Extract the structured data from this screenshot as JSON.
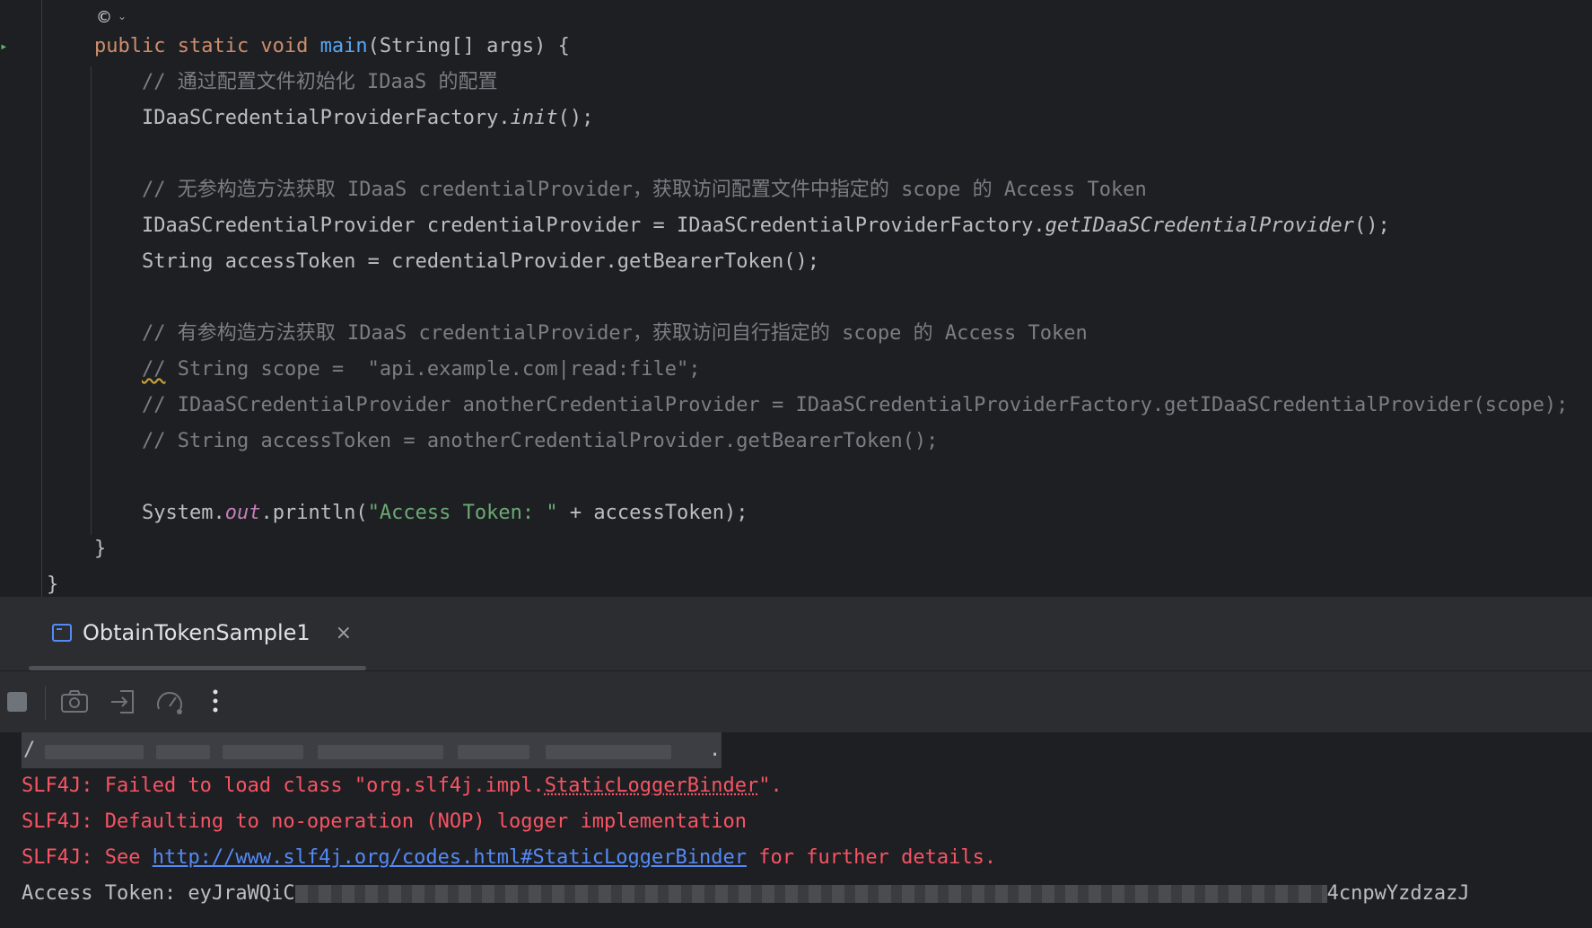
{
  "editor": {
    "hint_icon": "©",
    "lines": {
      "main_sig": {
        "kw": "public static void ",
        "fn": "main",
        "rest": "(String[] args) {"
      },
      "comment1": "// 通过配置文件初始化 IDaaS 的配置",
      "init_a": "IDaaSCredentialProviderFactory.",
      "init_b": "init",
      "init_c": "();",
      "comment2": "// 无参构造方法获取 IDaaS credentialProvider，获取访问配置文件中指定的 scope 的 Access Token",
      "provider_a": "IDaaSCredentialProvider credentialProvider = IDaaSCredentialProviderFactory.",
      "provider_b": "getIDaaSCredentialProvider",
      "provider_c": "();",
      "token_line": "String accessToken = credentialProvider.getBearerToken();",
      "comment3": "// 有参构造方法获取 IDaaS credentialProvider，获取访问自行指定的 scope 的 Access Token",
      "comment4_a": "//",
      "comment4_b": " String scope =  \"api.example.com|read:file\";",
      "comment5": "// IDaaSCredentialProvider anotherCredentialProvider = IDaaSCredentialProviderFactory.getIDaaSCredentialProvider(scope);",
      "comment6": "// String accessToken = anotherCredentialProvider.getBearerToken();",
      "println_a": "System.",
      "println_b": "out",
      "println_c": ".println(",
      "println_d": "\"Access Token: \"",
      "println_e": " + accessToken);",
      "close_inner": "}",
      "close_outer": "}"
    }
  },
  "run_panel": {
    "tab_label": "ObtainTokenSample1",
    "close_glyph": "×"
  },
  "console": {
    "path_start": "/",
    "path_end": ".",
    "line1_a": "SLF4J: Failed to load class \"org.slf4j.impl.",
    "line1_b": "StaticLoggerBinder",
    "line1_c": "\".",
    "line2": "SLF4J: Defaulting to no-operation (NOP) logger implementation",
    "line3_a": "SLF4J: See ",
    "line3_link": "http://www.slf4j.org/codes.html#StaticLoggerBinder",
    "line3_c": " for further details.",
    "line4_a": "Access Token: eyJraWQiC",
    "line4_b": "4cnpwYzdzazJ"
  },
  "colors": {
    "background": "#1e1f22",
    "panel": "#2b2d30",
    "keyword": "#cf8e6d",
    "function": "#56a8f5",
    "comment": "#7a7e85",
    "string": "#6aab73",
    "field": "#c77dbb",
    "error": "#f75464",
    "link": "#548af7"
  }
}
